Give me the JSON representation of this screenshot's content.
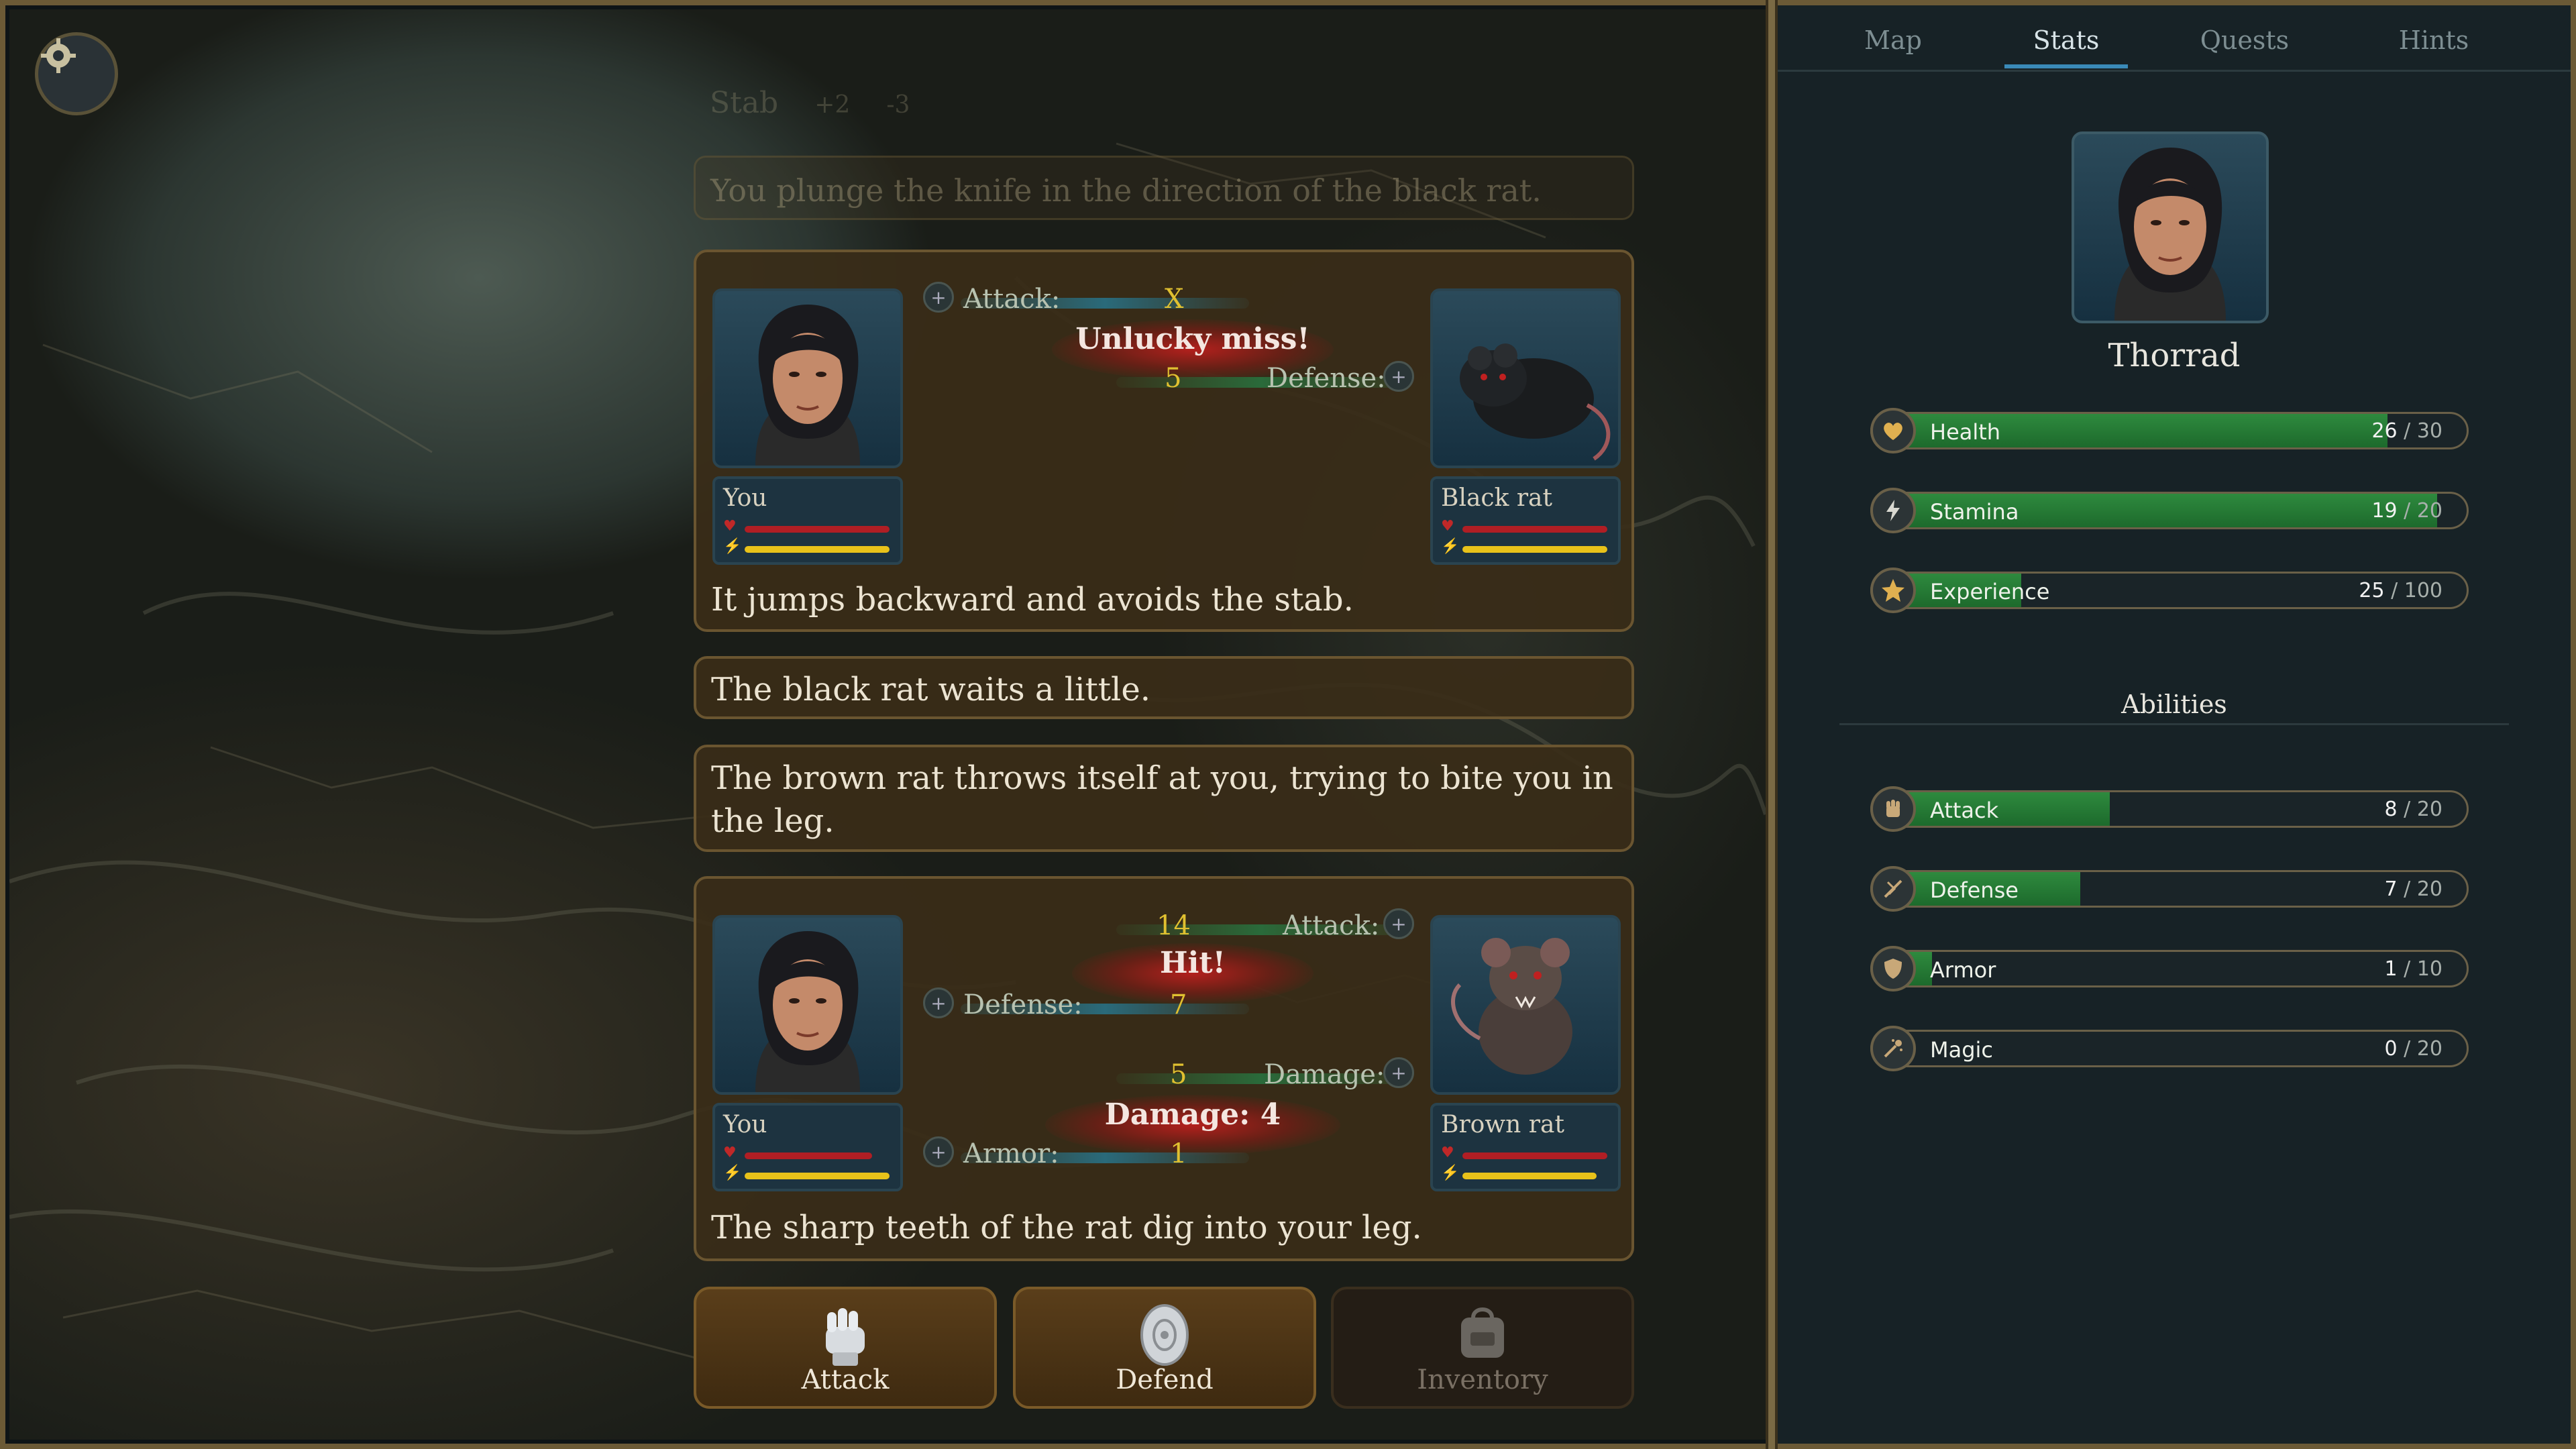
{
  "log": {
    "ghost_title": "Stab",
    "ghost_plus": "+2",
    "ghost_minus": "-3",
    "ghost_text": "You plunge the knife in the direction of the black rat.",
    "combat1": {
      "attack_label": "Attack:",
      "attack_value": "X",
      "defense_label": "Defense:",
      "defense_value": "5",
      "result": "Unlucky miss!",
      "left_name": "You",
      "right_name": "Black rat",
      "text": "It jumps backward and avoids the stab."
    },
    "msg1": "The black rat waits a little.",
    "msg2": "The brown rat throws itself at you, trying to bite you in the leg.",
    "combat2": {
      "attack_label": "Attack:",
      "attack_value": "14",
      "defense_label": "Defense:",
      "defense_value": "7",
      "result_hit": "Hit!",
      "damage_label": "Damage:",
      "damage_value": "5",
      "armor_label": "Armor:",
      "armor_value": "1",
      "result_damage": "Damage: 4",
      "left_name": "You",
      "right_name": "Brown rat",
      "text": "The sharp teeth of the rat dig into your leg."
    }
  },
  "actions": {
    "attack": "Attack",
    "defend": "Defend",
    "inventory": "Inventory"
  },
  "tabs": [
    "Map",
    "Stats",
    "Quests",
    "Hints"
  ],
  "active_tab": "Stats",
  "hero": {
    "name": "Thorrad"
  },
  "stats": [
    {
      "label": "Health",
      "value": "26",
      "max": "30",
      "icon": "heart-icon",
      "fill": 0.867
    },
    {
      "label": "Stamina",
      "value": "19",
      "max": "20",
      "icon": "lightning-icon",
      "fill": 0.95
    },
    {
      "label": "Experience",
      "value": "25",
      "max": "100",
      "icon": "star-icon",
      "fill": 0.25
    }
  ],
  "abilities_title": "Abilities",
  "abilities": [
    {
      "label": "Attack",
      "value": "8",
      "max": "20",
      "icon": "fist-icon",
      "fill": 0.4
    },
    {
      "label": "Defense",
      "value": "7",
      "max": "20",
      "icon": "deflect-icon",
      "fill": 0.35
    },
    {
      "label": "Armor",
      "value": "1",
      "max": "10",
      "icon": "shield-icon",
      "fill": 0.1
    },
    {
      "label": "Magic",
      "value": "0",
      "max": "20",
      "icon": "magic-icon",
      "fill": 0
    }
  ],
  "colors": {
    "health_fill": "#2e8a3e",
    "attack_value": "#e0c030",
    "miss_glow": "#c81e1e",
    "tab_accent": "#3a8ab8"
  }
}
